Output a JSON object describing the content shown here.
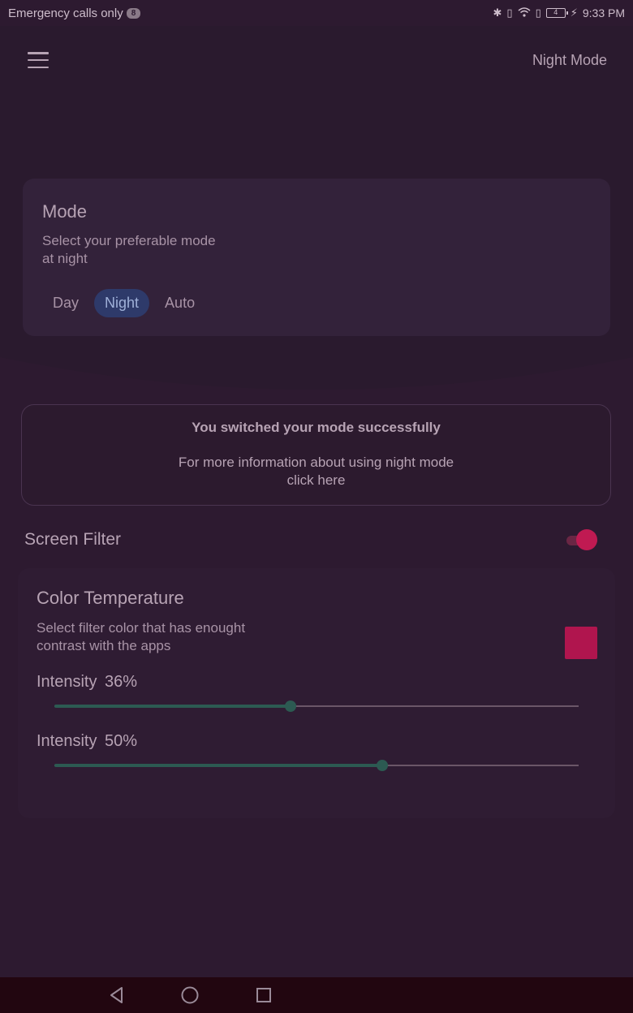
{
  "status_bar": {
    "carrier_text": "Emergency calls only",
    "notification_count": "8",
    "battery_level": "4",
    "time": "9:33 PM"
  },
  "app_bar": {
    "title": "Night Mode"
  },
  "mode_card": {
    "title": "Mode",
    "description": "Select your preferable mode\n at night",
    "options": [
      "Day",
      "Night",
      "Auto"
    ],
    "selected": "Night"
  },
  "notice": {
    "headline": "You switched your mode successfully",
    "line1": "For more information about using night mode",
    "line2": "click here"
  },
  "screen_filter": {
    "label": "Screen Filter",
    "enabled": true
  },
  "color_temperature": {
    "title": "Color Temperature",
    "description": "Select filter color that has enought\ncontrast with the apps",
    "swatch_color": "#b0154e",
    "sliders": [
      {
        "label": "Intensity",
        "value_text": "36%",
        "value": 0.45
      },
      {
        "label": "Intensity",
        "value_text": "50%",
        "value": 0.625
      }
    ]
  },
  "colors": {
    "background": "#2d1a30",
    "accent": "#c01a52",
    "selected_mode": "#2e3a6a",
    "slider": "#2c5a52"
  }
}
